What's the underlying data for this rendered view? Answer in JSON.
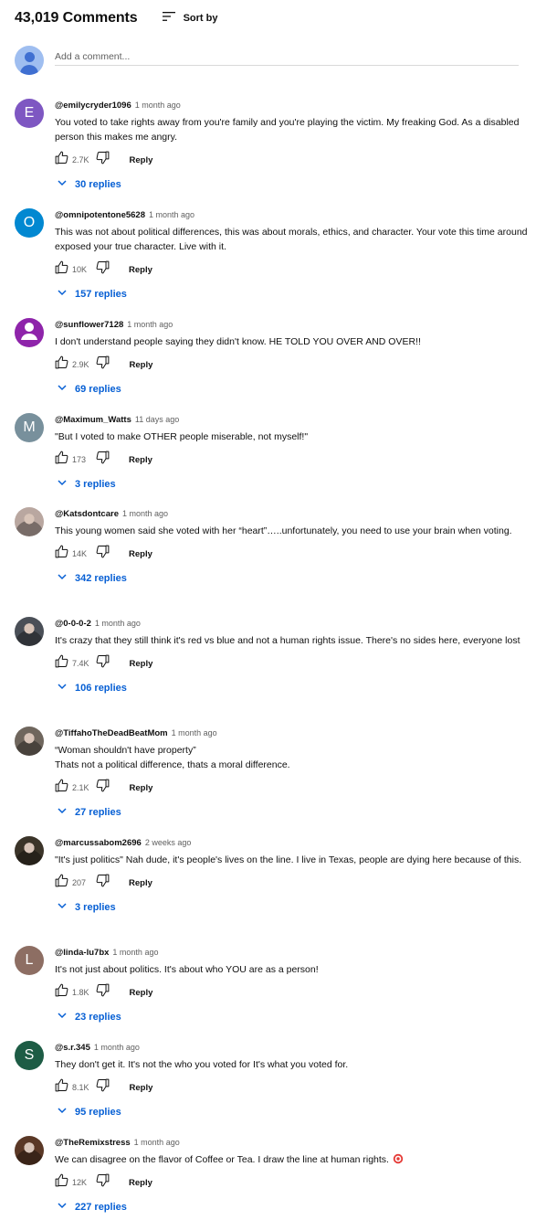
{
  "header": {
    "count": "43,019 Comments",
    "sort_label": "Sort by",
    "sort_icon": "sort-icon"
  },
  "add_comment": {
    "placeholder": "Add a comment..."
  },
  "comments": [
    {
      "handle": "@emilycryder1096",
      "time": "1 month ago",
      "avatar": {
        "type": "letter",
        "letter": "E",
        "color": "#7e57c2"
      },
      "text": "You voted to take rights away from you're family and you're playing the victim. My freaking God. As a disabled person this makes me angry.",
      "likes": "2.7K",
      "reply": "Reply",
      "replies": "30 replies"
    },
    {
      "handle": "@omnipotentone5628",
      "time": "1 month ago",
      "avatar": {
        "type": "letter",
        "letter": "O",
        "color": "#0288d1"
      },
      "text": "This was not about political differences, this was about morals, ethics, and character. Your vote this time around exposed your true character. Live with it.",
      "likes": "10K",
      "reply": "Reply",
      "replies": "157 replies"
    },
    {
      "handle": "@sunflower7128",
      "time": "1 month ago",
      "avatar": {
        "type": "person",
        "color": "#8e24aa"
      },
      "text": "I don't understand people saying they didn't know. HE TOLD YOU OVER AND OVER!!",
      "likes": "2.9K",
      "reply": "Reply",
      "replies": "69 replies"
    },
    {
      "handle": "@Maximum_Watts",
      "time": "11 days ago",
      "avatar": {
        "type": "letter",
        "letter": "M",
        "color": "#78909c"
      },
      "text": "\"But I voted to make OTHER people miserable, not myself!\"",
      "likes": "173",
      "reply": "Reply",
      "replies": "3 replies"
    },
    {
      "handle": "@Katsdontcare",
      "time": "1 month ago",
      "avatar": {
        "type": "photo",
        "color": "#b9a7a0"
      },
      "text": "This young women said she voted with her “heart”…..unfortunately, you need to use your brain when voting.",
      "likes": "14K",
      "reply": "Reply",
      "replies": "342 replies"
    },
    {
      "handle": "@0-0-0-2",
      "time": "1 month ago",
      "avatar": {
        "type": "photo",
        "color": "#4a4f57"
      },
      "text": "It's crazy that they still think it's red vs blue and not a human rights issue. There's no sides here, everyone lost",
      "likes": "7.4K",
      "reply": "Reply",
      "replies": "106 replies"
    },
    {
      "handle": "@TiffahoTheDeadBeatMom",
      "time": "1 month ago",
      "avatar": {
        "type": "photo",
        "color": "#6f665d"
      },
      "text": "“Woman shouldn't have property”\nThats not a political difference, thats a moral difference.",
      "likes": "2.1K",
      "reply": "Reply",
      "replies": "27 replies"
    },
    {
      "handle": "@marcussabom2696",
      "time": "2 weeks ago",
      "avatar": {
        "type": "photo",
        "color": "#3b3429"
      },
      "text": "\"It's just politics\" Nah dude, it's people's lives on the line. I live in Texas, people are dying here because of this.",
      "likes": "207",
      "reply": "Reply",
      "replies": "3 replies"
    },
    {
      "handle": "@linda-lu7bx",
      "time": "1 month ago",
      "avatar": {
        "type": "letter",
        "letter": "L",
        "color": "#8d6e63"
      },
      "text": "It's not just about politics. It's about who YOU are as a person!",
      "likes": "1.8K",
      "reply": "Reply",
      "replies": "23 replies"
    },
    {
      "handle": "@s.r.345",
      "time": "1 month ago",
      "avatar": {
        "type": "letter",
        "letter": "S",
        "color": "#1d5c45"
      },
      "text": "They don't get it. It's not the who you voted for It's what you voted for.",
      "likes": "8.1K",
      "reply": "Reply",
      "replies": "95 replies"
    },
    {
      "handle": "@TheRemixstress",
      "time": "1 month ago",
      "avatar": {
        "type": "photo",
        "color": "#5a3826"
      },
      "text": "We can disagree on the flavor of Coffee or Tea. I draw the line at human rights.",
      "emoji": "target-emoji-icon",
      "likes": "12K",
      "reply": "Reply",
      "replies": "227 replies"
    }
  ]
}
